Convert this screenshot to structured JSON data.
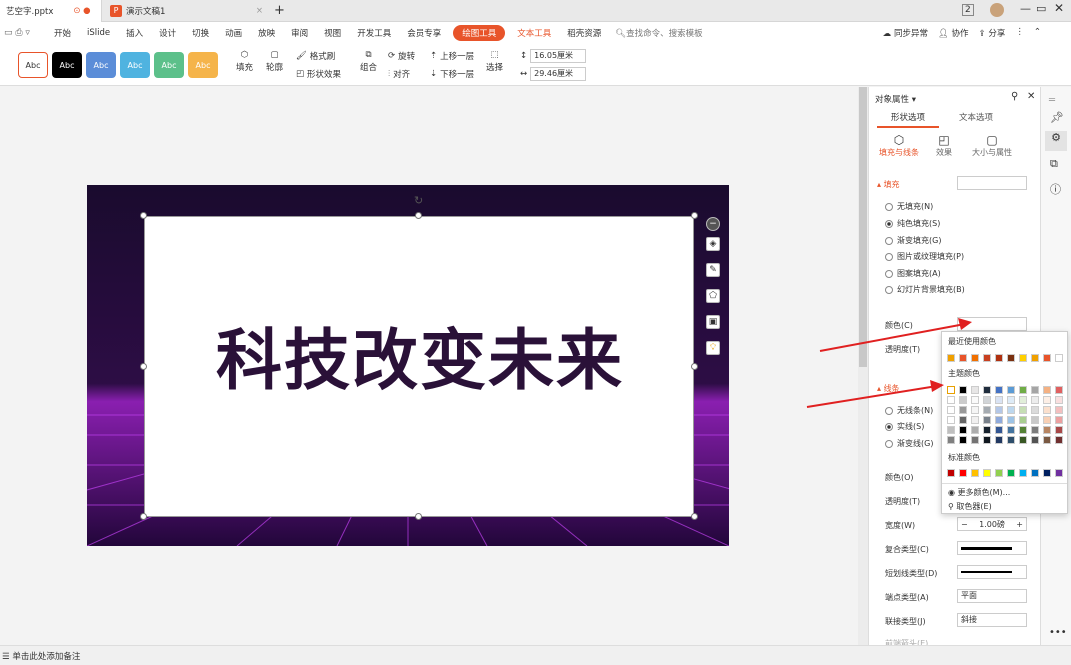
{
  "window": {
    "file_tab": "艺空字.pptx",
    "doc_tab": "演示文稿1"
  },
  "ribbon_tabs": [
    "开始",
    "iSlide",
    "插入",
    "设计",
    "切换",
    "动画",
    "放映",
    "审阅",
    "视图",
    "开发工具",
    "会员专享",
    "绘图工具",
    "文本工具",
    "稻壳资源"
  ],
  "search": {
    "placeholder": "查找命令、搜索模板"
  },
  "right_actions": {
    "sync": "同步异常",
    "collab": "协作",
    "share": "分享"
  },
  "toolbar": {
    "style_label": "Abc",
    "fill": "填充",
    "outline": "轮廓",
    "format_brush": "格式刷",
    "shape_effect": "形状效果",
    "group": "组合",
    "rotate": "旋转",
    "align": "对齐",
    "up_layer": "上移一层",
    "down_layer": "下移一层",
    "select": "选择",
    "height": "16.05厘米",
    "width": "29.46厘米"
  },
  "slide": {
    "title": "科技改变未来"
  },
  "panel": {
    "title": "对象属性",
    "tabs": [
      "形状选项",
      "文本选项"
    ],
    "subtabs": [
      "填充与线条",
      "效果",
      "大小与属性"
    ],
    "fill_section": "填充",
    "fill_options": [
      "无填充(N)",
      "纯色填充(S)",
      "渐变填充(G)",
      "图片或纹理填充(P)",
      "图案填充(A)",
      "幻灯片背景填充(B)"
    ],
    "color_label": "颜色(C)",
    "transparency_label": "透明度(T)",
    "line_section": "线条",
    "line_options": [
      "无线条(N)",
      "实线(S)",
      "渐变线(G)"
    ],
    "line_color_label": "颜色(O)",
    "line_transparency_label": "透明度(T)",
    "width_label": "宽度(W)",
    "width_value": "1.00磅",
    "compound_label": "复合类型(C)",
    "dash_label": "短划线类型(D)",
    "cap_label": "端点类型(A)",
    "cap_value": "平面",
    "join_label": "联接类型(J)",
    "join_value": "斜接",
    "arrow_label": "前端箭头(E)"
  },
  "palette": {
    "recent": "最近使用颜色",
    "theme": "主题颜色",
    "standard": "标准颜色",
    "more": "更多颜色(M)...",
    "picker": "取色器(E)",
    "recent_colors": [
      "#f0a000",
      "#e8542a",
      "#f07000",
      "#c84020",
      "#b03010",
      "#7a3010",
      "#ffd000",
      "#f0a000",
      "#e8542a",
      "#ffffff"
    ],
    "theme_top": [
      "#ffffff",
      "#000000",
      "#e7e6e6",
      "#1f2d3d",
      "#4472c4",
      "#5b9bd5",
      "#70ad47",
      "#a5a5a5",
      "#f4b183",
      "#e06060"
    ],
    "standard_colors": [
      "#c00000",
      "#ff0000",
      "#ffc000",
      "#ffff00",
      "#92d050",
      "#00b050",
      "#00b0f0",
      "#0070c0",
      "#002060",
      "#7030a0"
    ]
  },
  "status": {
    "note": "单击此处添加备注"
  }
}
